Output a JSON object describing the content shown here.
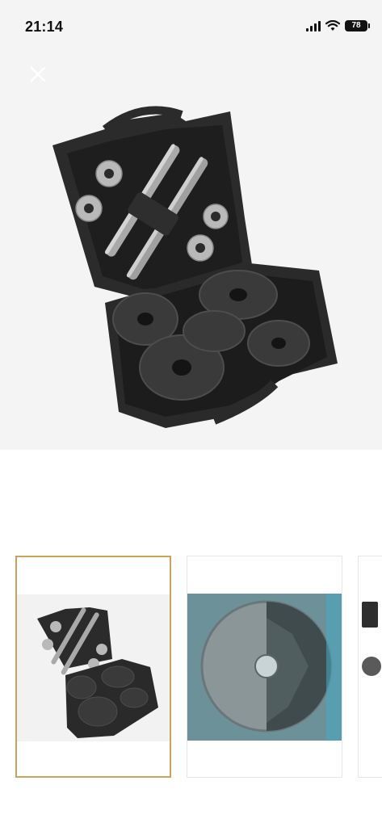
{
  "status_bar": {
    "time": "21:14",
    "battery_level": "78",
    "icons": [
      "signal-icon",
      "wifi-icon",
      "battery-icon"
    ]
  },
  "toolbar": {
    "close_icon": "close-icon"
  },
  "gallery": {
    "main_image": "dumbbell-case-image",
    "thumbnails": [
      {
        "image": "dumbbell-case-thumbnail",
        "selected": true
      },
      {
        "image": "weight-plate-closeup-thumbnail",
        "selected": false
      },
      {
        "image": "partial-thumbnail",
        "selected": false
      }
    ]
  },
  "colors": {
    "selected_border": "#c8a45a",
    "background": "#f4f4f4"
  }
}
